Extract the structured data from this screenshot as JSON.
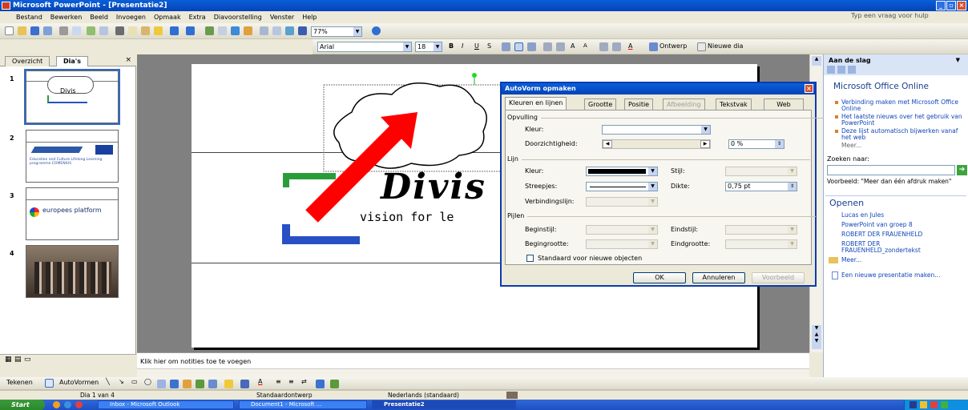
{
  "window": {
    "title": "Microsoft PowerPoint - [Presentatie2]"
  },
  "menu": {
    "items": [
      "Bestand",
      "Bewerken",
      "Beeld",
      "Invoegen",
      "Opmaak",
      "Extra",
      "Diavoorstelling",
      "Venster",
      "Help"
    ],
    "help_placeholder": "Typ een vraag voor hulp"
  },
  "toolbar": {
    "zoom": "77%",
    "font": "Arial",
    "font_size": "18",
    "bold": "B",
    "italic": "I",
    "underline": "U",
    "shadow": "S",
    "design_label": "Ontwerp",
    "new_slide_label": "Nieuwe dia"
  },
  "leftpane": {
    "tab_outline": "Overzicht",
    "tab_slides": "Dia's",
    "slides": [
      {
        "number": "1",
        "text": "Divis"
      },
      {
        "number": "2",
        "text": "Education and Culture Lifelong Learning programme COMENIUS"
      },
      {
        "number": "3",
        "text": "europees platform"
      },
      {
        "number": "4",
        "text": ""
      }
    ]
  },
  "slide": {
    "logo_text": "Divis",
    "tagline": "vision for le"
  },
  "dialog": {
    "title": "AutoVorm opmaken",
    "tabs": [
      {
        "label": "Kleuren en lijnen",
        "state": "active"
      },
      {
        "label": "Grootte",
        "state": "normal"
      },
      {
        "label": "Positie",
        "state": "normal"
      },
      {
        "label": "Afbeelding",
        "state": "disabled"
      },
      {
        "label": "Tekstvak",
        "state": "normal"
      },
      {
        "label": "Web",
        "state": "normal"
      }
    ],
    "fill_section": "Opvulling",
    "color_label": "Kleur:",
    "transparency_label": "Doorzichtigheid:",
    "transparency_value": "0 %",
    "line_section": "Lijn",
    "line_color_label": "Kleur:",
    "style_label": "Stijl:",
    "dashed_label": "Streepjes:",
    "weight_label": "Dikte:",
    "weight_value": "0,75 pt",
    "connector_label": "Verbindingslijn:",
    "arrows_section": "Pijlen",
    "begin_style_label": "Beginstijl:",
    "end_style_label": "Eindstijl:",
    "begin_size_label": "Begingrootte:",
    "end_size_label": "Eindgrootte:",
    "default_checkbox_label": "Standaard voor nieuwe objecten",
    "ok_label": "OK",
    "cancel_label": "Annuleren",
    "preview_label": "Voorbeeld"
  },
  "taskpane": {
    "title": "Aan de slag",
    "office_heading": "Microsoft Office Online",
    "links": [
      "Verbinding maken met Microsoft Office Online",
      "Het laatste nieuws over het gebruik van PowerPoint",
      "Deze lijst automatisch bijwerken vanaf het web"
    ],
    "more": "Meer...",
    "search_label": "Zoeken naar:",
    "example_text": "Voorbeeld: \"Meer dan één afdruk maken\"",
    "open_heading": "Openen",
    "recent": [
      "Lucas en Jules",
      "PowerPoint van groep 8",
      "ROBERT DER FRAUENHELD",
      "ROBERT DER FRAUENHELD_zondertekst"
    ],
    "open_more": "Meer...",
    "new_presentation": "Een nieuwe presentatie maken..."
  },
  "notes": {
    "placeholder": "Klik hier om notities toe te voegen"
  },
  "drawbar": {
    "draw_label": "Tekenen",
    "autoshapes_label": "AutoVormen"
  },
  "status": {
    "slide_of": "Dia 1 van 4",
    "design": "Standaardontwerp",
    "language": "Nederlands (standaard)"
  },
  "taskbar": {
    "start": "Start",
    "items": [
      {
        "label": "Inbox - Microsoft Outlook",
        "active": false
      },
      {
        "label": "Document1 - Microsoft ...",
        "active": false
      },
      {
        "label": "Presentatie2",
        "active": true
      }
    ]
  },
  "colors": {
    "title_blue": "#0443b8",
    "arrow_red": "#ff0000",
    "slide_bg": "#ffffff",
    "canvas_gray": "#808080"
  }
}
